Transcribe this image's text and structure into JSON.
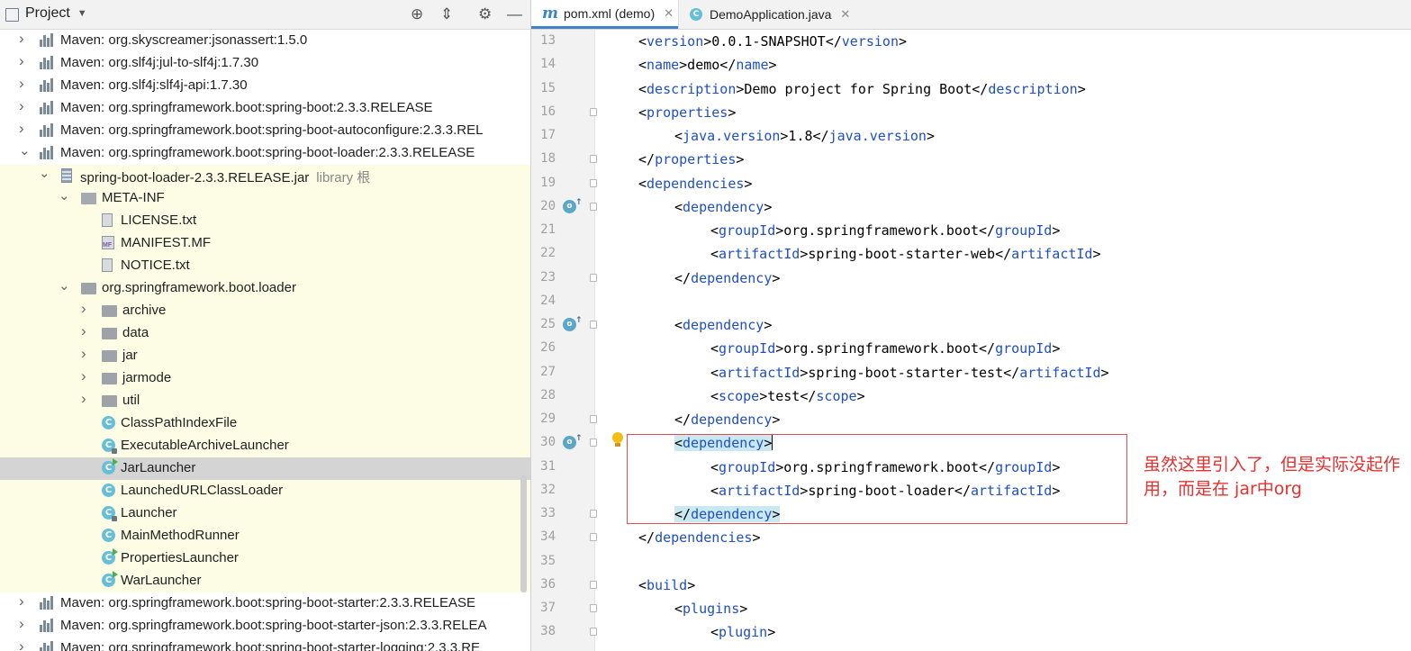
{
  "project_panel": {
    "title": "Project",
    "tree": [
      {
        "label": "Maven: org.skyscreamer:jsonassert:1.5.0",
        "icon": "maven-library-icon",
        "expanded": false
      },
      {
        "label": "Maven: org.slf4j:jul-to-slf4j:1.7.30",
        "icon": "maven-library-icon",
        "expanded": false
      },
      {
        "label": "Maven: org.slf4j:slf4j-api:1.7.30",
        "icon": "maven-library-icon",
        "expanded": false
      },
      {
        "label": "Maven: org.springframework.boot:spring-boot:2.3.3.RELEASE",
        "icon": "maven-library-icon",
        "expanded": false
      },
      {
        "label": "Maven: org.springframework.boot:spring-boot-autoconfigure:2.3.3.REL",
        "icon": "maven-library-icon",
        "expanded": false
      },
      {
        "label": "Maven: org.springframework.boot:spring-boot-loader:2.3.3.RELEASE",
        "icon": "maven-library-icon",
        "expanded": true
      },
      {
        "label": "spring-boot-loader-2.3.3.RELEASE.jar",
        "sub": "library 根",
        "icon": "jar-icon",
        "expanded": true
      },
      {
        "label": "META-INF",
        "icon": "folder-icon",
        "expanded": true
      },
      {
        "label": "LICENSE.txt",
        "icon": "text-file-icon"
      },
      {
        "label": "MANIFEST.MF",
        "icon": "manifest-file-icon"
      },
      {
        "label": "NOTICE.txt",
        "icon": "text-file-icon"
      },
      {
        "label": "org.springframework.boot.loader",
        "icon": "package-icon",
        "expanded": true
      },
      {
        "label": "archive",
        "icon": "package-icon",
        "expanded": false
      },
      {
        "label": "data",
        "icon": "package-icon",
        "expanded": false
      },
      {
        "label": "jar",
        "icon": "package-icon",
        "expanded": false
      },
      {
        "label": "jarmode",
        "icon": "package-icon",
        "expanded": false
      },
      {
        "label": "util",
        "icon": "package-icon",
        "expanded": false
      },
      {
        "label": "ClassPathIndexFile",
        "icon": "class-icon"
      },
      {
        "label": "ExecutableArchiveLauncher",
        "icon": "abstract-class-icon"
      },
      {
        "label": "JarLauncher",
        "icon": "runnable-class-icon",
        "selected": true
      },
      {
        "label": "LaunchedURLClassLoader",
        "icon": "class-icon"
      },
      {
        "label": "Launcher",
        "icon": "abstract-class-icon"
      },
      {
        "label": "MainMethodRunner",
        "icon": "class-icon"
      },
      {
        "label": "PropertiesLauncher",
        "icon": "runnable-class-icon"
      },
      {
        "label": "WarLauncher",
        "icon": "runnable-class-icon"
      },
      {
        "label": "Maven: org.springframework.boot:spring-boot-starter:2.3.3.RELEASE",
        "icon": "maven-library-icon",
        "expanded": false
      },
      {
        "label": "Maven: org.springframework.boot:spring-boot-starter-json:2.3.3.RELEA",
        "icon": "maven-library-icon",
        "expanded": false
      },
      {
        "label": "Maven: org.springframework.boot:spring-boot-starter-logging:2.3.3.RE",
        "icon": "maven-library-icon",
        "expanded": false
      }
    ]
  },
  "editor": {
    "tabs": [
      {
        "label": "pom.xml (demo)",
        "icon": "maven-m-icon",
        "active": true
      },
      {
        "label": "DemoApplication.java",
        "icon": "spring-class-icon",
        "active": false
      }
    ],
    "lines": [
      {
        "num": "13",
        "indent": 1,
        "parts": [
          [
            "t",
            "<"
          ],
          [
            "g",
            "version"
          ],
          [
            "t",
            ">0.0.1-SNAPSHOT</"
          ],
          [
            "g",
            "version"
          ],
          [
            "t",
            ">"
          ]
        ]
      },
      {
        "num": "14",
        "indent": 1,
        "parts": [
          [
            "t",
            "<"
          ],
          [
            "g",
            "name"
          ],
          [
            "t",
            ">demo</"
          ],
          [
            "g",
            "name"
          ],
          [
            "t",
            ">"
          ]
        ]
      },
      {
        "num": "15",
        "indent": 1,
        "parts": [
          [
            "t",
            "<"
          ],
          [
            "g",
            "description"
          ],
          [
            "t",
            ">Demo project for Spring Boot</"
          ],
          [
            "g",
            "description"
          ],
          [
            "t",
            ">"
          ]
        ]
      },
      {
        "num": "16",
        "indent": 1,
        "fold": true,
        "parts": [
          [
            "t",
            "<"
          ],
          [
            "g",
            "properties"
          ],
          [
            "t",
            ">"
          ]
        ]
      },
      {
        "num": "17",
        "indent": 2,
        "parts": [
          [
            "t",
            "<"
          ],
          [
            "g",
            "java.version"
          ],
          [
            "t",
            ">1.8</"
          ],
          [
            "g",
            "java.version"
          ],
          [
            "t",
            ">"
          ]
        ]
      },
      {
        "num": "18",
        "indent": 1,
        "fold": true,
        "parts": [
          [
            "t",
            "</"
          ],
          [
            "g",
            "properties"
          ],
          [
            "t",
            ">"
          ]
        ]
      },
      {
        "num": "19",
        "indent": 1,
        "fold": true,
        "parts": [
          [
            "t",
            "<"
          ],
          [
            "g",
            "dependencies"
          ],
          [
            "t",
            ">"
          ]
        ]
      },
      {
        "num": "20",
        "indent": 2,
        "fold": true,
        "gutter_icon": "implemented-icon",
        "parts": [
          [
            "t",
            "<"
          ],
          [
            "g",
            "dependency"
          ],
          [
            "t",
            ">"
          ]
        ]
      },
      {
        "num": "21",
        "indent": 3,
        "parts": [
          [
            "t",
            "<"
          ],
          [
            "g",
            "groupId"
          ],
          [
            "t",
            ">org.springframework.boot</"
          ],
          [
            "g",
            "groupId"
          ],
          [
            "t",
            ">"
          ]
        ]
      },
      {
        "num": "22",
        "indent": 3,
        "parts": [
          [
            "t",
            "<"
          ],
          [
            "g",
            "artifactId"
          ],
          [
            "t",
            ">spring-boot-starter-web</"
          ],
          [
            "g",
            "artifactId"
          ],
          [
            "t",
            ">"
          ]
        ]
      },
      {
        "num": "23",
        "indent": 2,
        "fold": true,
        "parts": [
          [
            "t",
            "</"
          ],
          [
            "g",
            "dependency"
          ],
          [
            "t",
            ">"
          ]
        ]
      },
      {
        "num": "24",
        "indent": 0,
        "parts": []
      },
      {
        "num": "25",
        "indent": 2,
        "fold": true,
        "gutter_icon": "implemented-icon",
        "parts": [
          [
            "t",
            "<"
          ],
          [
            "g",
            "dependency"
          ],
          [
            "t",
            ">"
          ]
        ]
      },
      {
        "num": "26",
        "indent": 3,
        "parts": [
          [
            "t",
            "<"
          ],
          [
            "g",
            "groupId"
          ],
          [
            "t",
            ">org.springframework.boot</"
          ],
          [
            "g",
            "groupId"
          ],
          [
            "t",
            ">"
          ]
        ]
      },
      {
        "num": "27",
        "indent": 3,
        "parts": [
          [
            "t",
            "<"
          ],
          [
            "g",
            "artifactId"
          ],
          [
            "t",
            ">spring-boot-starter-test</"
          ],
          [
            "g",
            "artifactId"
          ],
          [
            "t",
            ">"
          ]
        ]
      },
      {
        "num": "28",
        "indent": 3,
        "parts": [
          [
            "t",
            "<"
          ],
          [
            "g",
            "scope"
          ],
          [
            "t",
            ">test</"
          ],
          [
            "g",
            "scope"
          ],
          [
            "t",
            ">"
          ]
        ]
      },
      {
        "num": "29",
        "indent": 2,
        "fold": true,
        "parts": [
          [
            "t",
            "</"
          ],
          [
            "g",
            "dependency"
          ],
          [
            "t",
            ">"
          ]
        ]
      },
      {
        "num": "30",
        "indent": 2,
        "fold": true,
        "gutter_icon": "implemented-icon",
        "highlight": true,
        "caret": true,
        "parts": [
          [
            "t",
            "<"
          ],
          [
            "g",
            "dependency"
          ],
          [
            "t",
            ">"
          ]
        ]
      },
      {
        "num": "31",
        "indent": 3,
        "parts": [
          [
            "t",
            "<"
          ],
          [
            "g",
            "groupId"
          ],
          [
            "t",
            ">org.springframework.boot</"
          ],
          [
            "g",
            "groupId"
          ],
          [
            "t",
            ">"
          ]
        ]
      },
      {
        "num": "32",
        "indent": 3,
        "parts": [
          [
            "t",
            "<"
          ],
          [
            "g",
            "artifactId"
          ],
          [
            "t",
            ">spring-boot-loader</"
          ],
          [
            "g",
            "artifactId"
          ],
          [
            "t",
            ">"
          ]
        ]
      },
      {
        "num": "33",
        "indent": 2,
        "fold": true,
        "highlight": true,
        "parts": [
          [
            "t",
            "</"
          ],
          [
            "g",
            "dependency"
          ],
          [
            "t",
            ">"
          ]
        ]
      },
      {
        "num": "34",
        "indent": 1,
        "fold": true,
        "parts": [
          [
            "t",
            "</"
          ],
          [
            "g",
            "dependencies"
          ],
          [
            "t",
            ">"
          ]
        ]
      },
      {
        "num": "35",
        "indent": 0,
        "parts": []
      },
      {
        "num": "36",
        "indent": 1,
        "fold": true,
        "parts": [
          [
            "t",
            "<"
          ],
          [
            "g",
            "build"
          ],
          [
            "t",
            ">"
          ]
        ]
      },
      {
        "num": "37",
        "indent": 2,
        "fold": true,
        "parts": [
          [
            "t",
            "<"
          ],
          [
            "g",
            "plugins"
          ],
          [
            "t",
            ">"
          ]
        ]
      },
      {
        "num": "38",
        "indent": 3,
        "fold": true,
        "parts": [
          [
            "t",
            "<"
          ],
          [
            "g",
            "plugin"
          ],
          [
            "t",
            ">"
          ]
        ]
      }
    ]
  },
  "annotation": {
    "text": "虽然这里引入了，但是实际没起作用，而是在 jar中org",
    "color": "#e4312f"
  },
  "colors": {
    "tag": "#1f4fc3",
    "library_background": "#fdfde6",
    "selected_row": "#d4d4d4",
    "active_tab_underline": "#4083c9"
  }
}
